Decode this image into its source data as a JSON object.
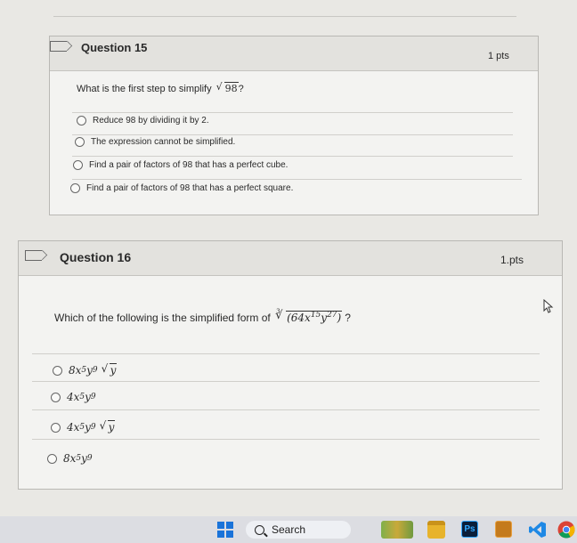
{
  "q15": {
    "title": "Question 15",
    "points": "1 pts",
    "prompt": "What is the first step to simplify",
    "radicand": "98",
    "qmark": "?",
    "answers": [
      "Reduce 98 by dividing it by 2.",
      "The expression cannot be simplified.",
      "Find a pair of factors of 98 that has a perfect cube.",
      "Find a pair of factors of 98 that has a perfect square."
    ]
  },
  "q16": {
    "title": "Question 16",
    "points": "1.pts",
    "prompt": "Which of the following is the simplified form of",
    "cube_index": "3",
    "radicand": "(64x",
    "exp1": "15",
    "y": "y",
    "exp2": "27",
    "close": ")",
    "qmark": "?",
    "answers": [
      {
        "coef": "8x",
        "e1": "5",
        "y": "y",
        "e2": "9",
        "root": "y"
      },
      {
        "coef": "4x",
        "e1": "5",
        "y": "y",
        "e2": "9",
        "root": ""
      },
      {
        "coef": "4x",
        "e1": "5",
        "y": "y",
        "e2": "9",
        "root": "y"
      },
      {
        "coef": "8x",
        "e1": "5",
        "y": "y",
        "e2": "9",
        "root": ""
      }
    ]
  },
  "taskbar": {
    "search_label": "Search",
    "ps_label": "Ps"
  }
}
